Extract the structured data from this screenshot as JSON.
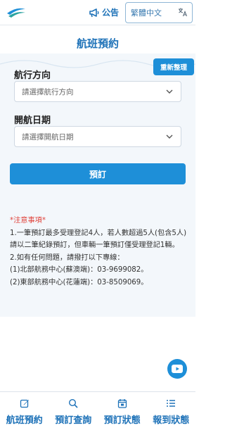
{
  "header": {
    "announce_label": "公告",
    "language": {
      "selected": "繁體中文"
    }
  },
  "page_title": "航班預約",
  "form": {
    "reset_label": "重新整理",
    "direction": {
      "label": "航行方向",
      "placeholder": "請選擇航行方向"
    },
    "date": {
      "label": "開航日期",
      "placeholder": "請選擇開航日期"
    },
    "submit_label": "預訂"
  },
  "notice": {
    "title": "*注意事項*",
    "lines": [
      "1.一筆預訂最多受理登記4人，若人數超過5人(包含5人)請以二筆紀錄預訂，但車輛一筆預訂僅受理登記1輛。",
      "2.如有任何問題，請撥打以下專線：",
      "(1)北部航務中心(蘇澳端)：03-9699082。",
      "(2)東部航務中心(花蓮端)：03-8509069。"
    ]
  },
  "bottom_nav": [
    {
      "label": "航班預約",
      "icon": "edit-icon"
    },
    {
      "label": "預訂查詢",
      "icon": "search-icon"
    },
    {
      "label": "預訂狀態",
      "icon": "calendar-icon"
    },
    {
      "label": "報到狀態",
      "icon": "list-icon"
    }
  ],
  "colors": {
    "primary": "#1e8fd8",
    "title_blue": "#1e72b8",
    "notice_red": "#e0443c"
  }
}
